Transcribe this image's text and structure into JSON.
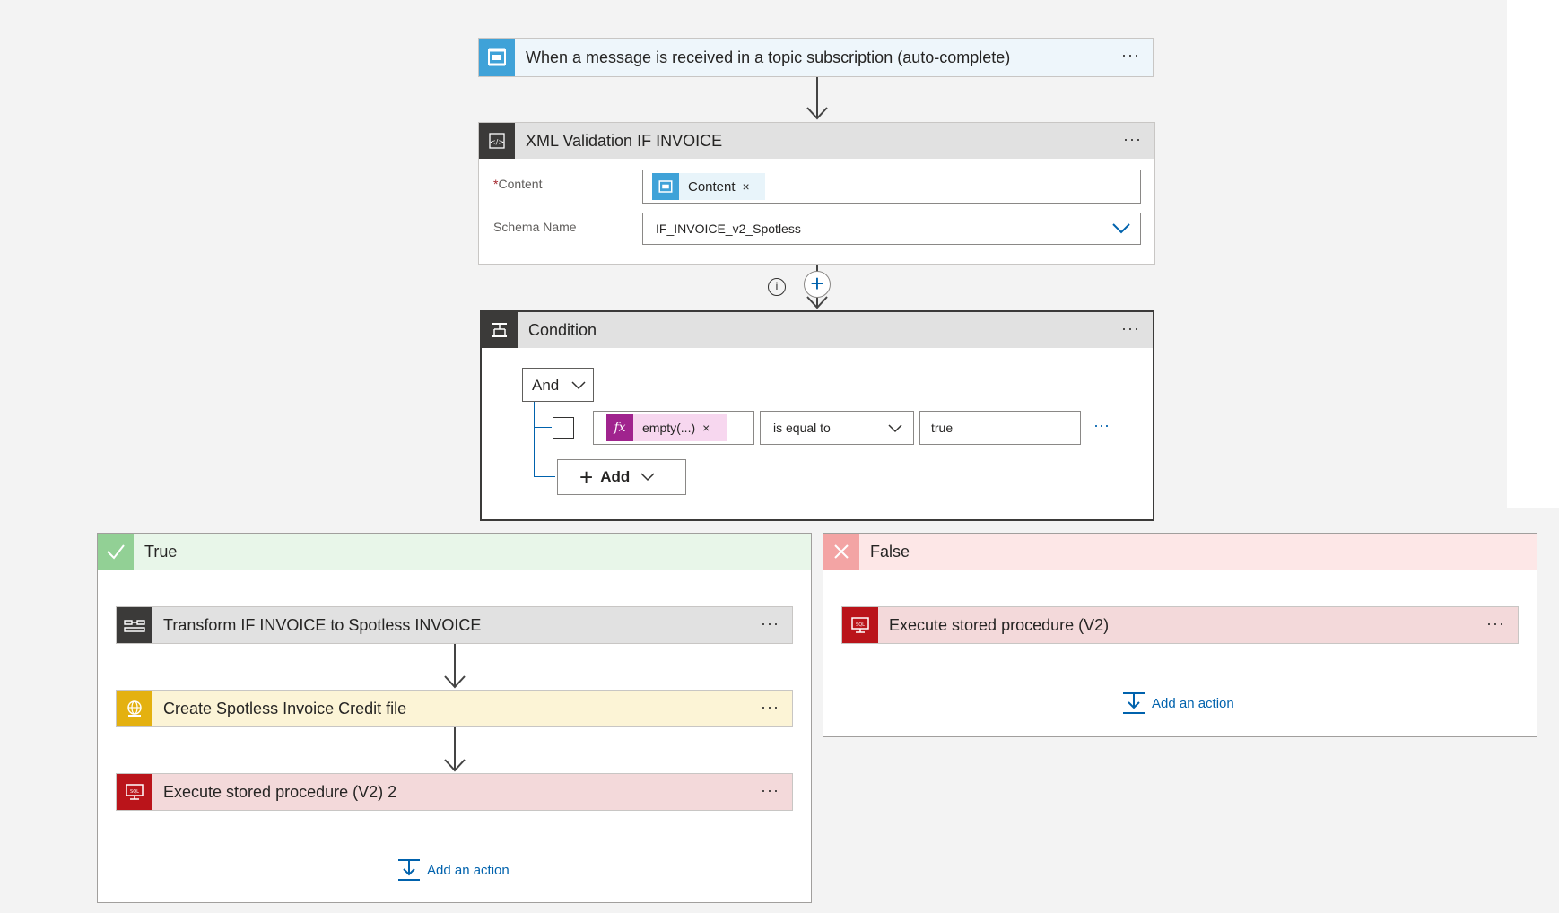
{
  "trigger": {
    "title": "When a message is received in a topic subscription (auto-complete)",
    "menu": "···"
  },
  "xml_validation": {
    "title": "XML Validation IF INVOICE",
    "menu": "···",
    "content_required_mark": "*",
    "content_label": "Content",
    "content_token": "Content",
    "token_remove": "×",
    "schema_label": "Schema Name",
    "schema_value": "IF_INVOICE_v2_Spotless"
  },
  "connector": {
    "info": "i",
    "plus": "+"
  },
  "condition": {
    "title": "Condition",
    "menu": "···",
    "group_operator": "And",
    "row": {
      "fx": "fx",
      "left_token": "empty(...)",
      "token_remove": "×",
      "operator": "is equal to",
      "value": "true",
      "menu": "···"
    },
    "add_label": "Add"
  },
  "true_branch": {
    "title": "True",
    "actions": [
      {
        "title": "Transform IF INVOICE to Spotless INVOICE",
        "menu": "···"
      },
      {
        "title": "Create Spotless Invoice Credit file",
        "menu": "···"
      },
      {
        "title": "Execute stored procedure (V2) 2",
        "menu": "···"
      }
    ],
    "add_action": "Add an action"
  },
  "false_branch": {
    "title": "False",
    "actions": [
      {
        "title": "Execute stored procedure (V2)",
        "menu": "···"
      }
    ],
    "add_action": "Add an action"
  },
  "colors": {
    "service_bus": "#3fa2d8",
    "xml_icon": "#3b3a39",
    "condition_icon": "#3b3a39",
    "transform_icon": "#3b3a39",
    "file_icon": "#e4b110",
    "sql_icon": "#ba141a",
    "true_head": "#e8f6e9",
    "false_head": "#fde7e7",
    "link": "#0062ad"
  }
}
